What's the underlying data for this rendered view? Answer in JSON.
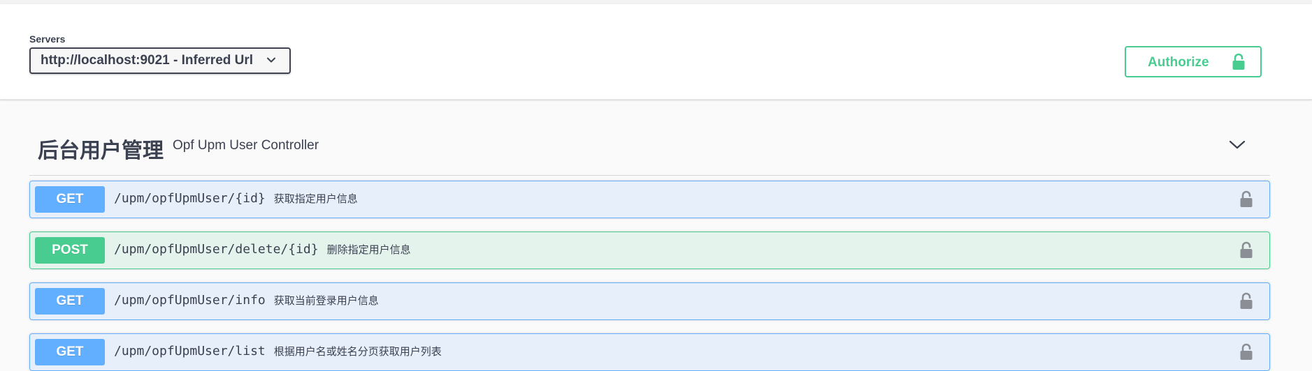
{
  "servers": {
    "label": "Servers",
    "selected": "http://localhost:9021 - Inferred Url"
  },
  "authorize": {
    "label": "Authorize"
  },
  "tag": {
    "name": "后台用户管理",
    "description": "Opf Upm User Controller"
  },
  "operations": [
    {
      "method": "GET",
      "path": "/upm/opfUpmUser/{id}",
      "summary": "获取指定用户信息"
    },
    {
      "method": "POST",
      "path": "/upm/opfUpmUser/delete/{id}",
      "summary": "删除指定用户信息"
    },
    {
      "method": "GET",
      "path": "/upm/opfUpmUser/info",
      "summary": "获取当前登录用户信息"
    },
    {
      "method": "GET",
      "path": "/upm/opfUpmUser/list",
      "summary": "根据用户名或姓名分页获取用户列表"
    }
  ],
  "colors": {
    "get": "#61affe",
    "post": "#49cc90",
    "text": "#3b4151"
  },
  "icons": {
    "server_dropdown": "chevron-down-icon",
    "authorize": "unlock-icon",
    "tag_toggle": "chevron-down-icon",
    "operation_lock": "lock-icon"
  }
}
